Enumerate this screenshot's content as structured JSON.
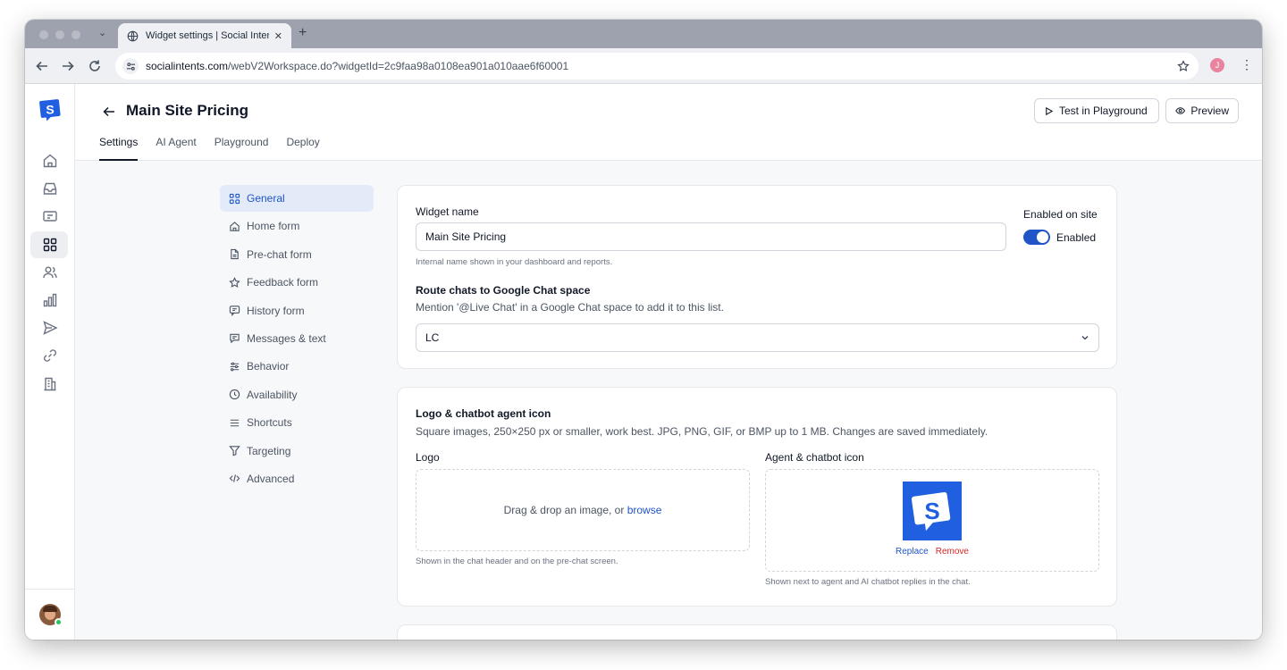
{
  "browser": {
    "tab_title": "Widget settings | Social Intents",
    "new_tab_symbol": "+",
    "close_symbol": "✕",
    "url_host": "socialintents.com",
    "url_path": "/webV2Workspace.do?widgetId=2c9faa98a0108ea901a010aae6f60001",
    "profile_initial": "J"
  },
  "header": {
    "title": "Main Site Pricing",
    "test_button": "Test in Playground",
    "preview_button": "Preview",
    "tabs": [
      {
        "label": "Settings"
      },
      {
        "label": "AI Agent"
      },
      {
        "label": "Playground"
      },
      {
        "label": "Deploy"
      }
    ]
  },
  "settings_nav": {
    "items": [
      {
        "label": "General",
        "icon": "grid-icon"
      },
      {
        "label": "Home form",
        "icon": "home-icon"
      },
      {
        "label": "Pre-chat form",
        "icon": "file-icon"
      },
      {
        "label": "Feedback form",
        "icon": "star-icon"
      },
      {
        "label": "History form",
        "icon": "chat-icon"
      },
      {
        "label": "Messages & text",
        "icon": "message-icon"
      },
      {
        "label": "Behavior",
        "icon": "sliders-icon"
      },
      {
        "label": "Availability",
        "icon": "clock-icon"
      },
      {
        "label": "Shortcuts",
        "icon": "list-icon"
      },
      {
        "label": "Targeting",
        "icon": "filter-icon"
      },
      {
        "label": "Advanced",
        "icon": "code-icon"
      }
    ]
  },
  "general": {
    "widget_name_label": "Widget name",
    "widget_name_value": "Main Site Pricing",
    "widget_name_hint": "Internal name shown in your dashboard and reports.",
    "enabled_label": "Enabled on site",
    "enabled_state": "Enabled",
    "route_label": "Route chats to Google Chat space",
    "route_desc": "Mention '@Live Chat' in a Google Chat space to add it to this list.",
    "route_value": "LC"
  },
  "logo_section": {
    "title": "Logo & chatbot agent icon",
    "desc": "Square images, 250×250 px or smaller, work best. JPG, PNG, GIF, or BMP up to 1 MB. Changes are saved immediately.",
    "logo_label": "Logo",
    "drop_text": "Drag & drop an image, or ",
    "browse": "browse",
    "logo_hint": "Shown in the chat header and on the pre-chat screen.",
    "agent_label": "Agent & chatbot icon",
    "replace": "Replace",
    "remove": "Remove",
    "agent_hint": "Shown next to agent and AI chatbot replies in the chat."
  },
  "colors": {
    "accent": "#1f55c7",
    "danger": "#dc2626"
  }
}
